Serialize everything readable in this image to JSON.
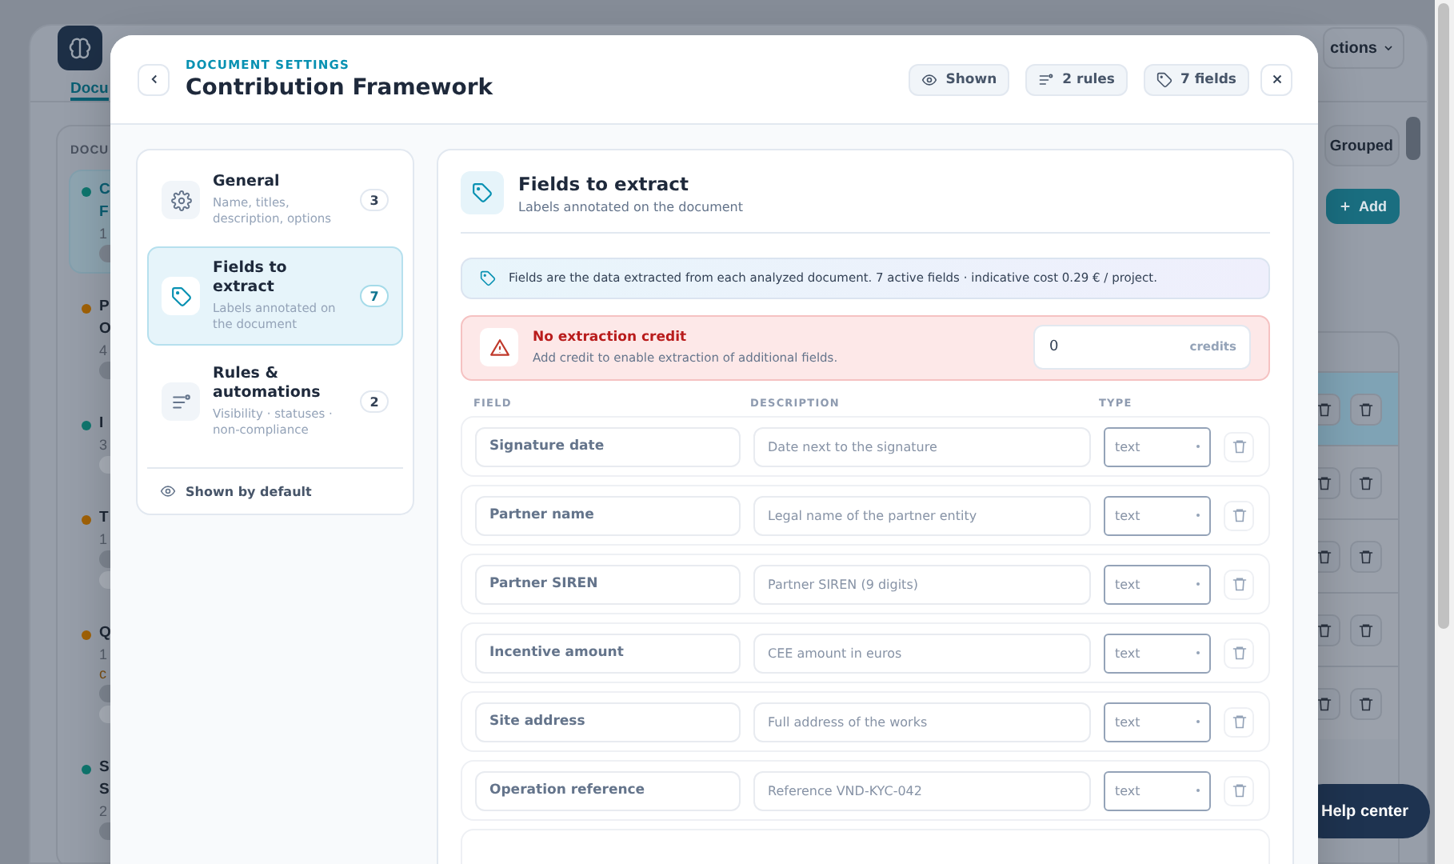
{
  "background": {
    "menu_button": "ctions",
    "tab": "Docu",
    "list_heading": "DOCU",
    "documents": [
      {
        "lines": [
          "C",
          "F"
        ],
        "meta": "1",
        "color": "#0f766e",
        "selected": true,
        "tags": [
          {
            "kind": "rule"
          }
        ]
      },
      {
        "lines": [
          "P",
          "O"
        ],
        "meta": "4",
        "color": "#a16207",
        "selected": false,
        "tags": [
          {
            "kind": "rule"
          }
        ]
      },
      {
        "lines": [
          "I"
        ],
        "meta": "3",
        "color": "#0f766e",
        "selected": false,
        "tags": [
          {
            "kind": "field"
          }
        ]
      },
      {
        "lines": [
          "T"
        ],
        "meta": "1",
        "color": "#a16207",
        "selected": false,
        "tags": [
          {
            "kind": "rule"
          },
          {
            "kind": "field"
          }
        ]
      },
      {
        "lines": [
          "Q"
        ],
        "meta": "1",
        "note": "c",
        "color": "#a16207",
        "selected": false,
        "tags": [
          {
            "kind": "rule"
          },
          {
            "kind": "field"
          }
        ]
      },
      {
        "lines": [
          "S",
          "S"
        ],
        "meta": "2",
        "color": "#0f766e",
        "selected": false,
        "tags": [
          {
            "kind": "rule"
          }
        ]
      }
    ],
    "grouped_button": "Grouped",
    "add_button": "Add",
    "table_rows": [
      {
        "selected": true
      },
      {
        "selected": false
      },
      {
        "selected": false
      },
      {
        "selected": false
      },
      {
        "selected": false
      }
    ],
    "help_button": "Help center"
  },
  "dialog": {
    "eyebrow": "DOCUMENT SETTINGS",
    "title": "Contribution Framework",
    "chips": [
      {
        "kind": "visibility",
        "label": "Shown"
      },
      {
        "kind": "rules",
        "label": "2 rules"
      },
      {
        "kind": "fields",
        "label": "7 fields"
      }
    ],
    "nav": [
      {
        "kind": "general",
        "title": "General",
        "subtitle": "Name, titles, description, options",
        "count": "3",
        "selected": false
      },
      {
        "kind": "fields",
        "title": "Fields to extract",
        "subtitle": "Labels annotated on the document",
        "count": "7",
        "selected": true
      },
      {
        "kind": "rules",
        "title": "Rules & automations",
        "subtitle": "Visibility · statuses · non-compliance",
        "count": "2",
        "selected": false
      }
    ],
    "nav_footer": "Shown by default",
    "section": {
      "title": "Fields to extract",
      "subtitle": "Labels annotated on the document",
      "info": "Fields are the data extracted from each analyzed document. 7 active fields · indicative cost 0.29 € / project.",
      "alert": {
        "title": "No extraction credit",
        "text": "Add credit to enable extraction of additional fields.",
        "value": "0",
        "unit": "credits"
      },
      "columns": [
        "FIELD",
        "DESCRIPTION",
        "TYPE"
      ],
      "fields": [
        {
          "name": "Signature date",
          "description": "Date next to the signature",
          "type": "text"
        },
        {
          "name": "Partner name",
          "description": "Legal name of the partner entity",
          "type": "text"
        },
        {
          "name": "Partner SIREN",
          "description": "Partner SIREN (9 digits)",
          "type": "text"
        },
        {
          "name": "Incentive amount",
          "description": "CEE amount in euros",
          "type": "text"
        },
        {
          "name": "Site address",
          "description": "Full address of the works",
          "type": "text"
        },
        {
          "name": "Operation reference",
          "description": "Reference VND-KYC-042",
          "type": "text"
        }
      ]
    }
  }
}
